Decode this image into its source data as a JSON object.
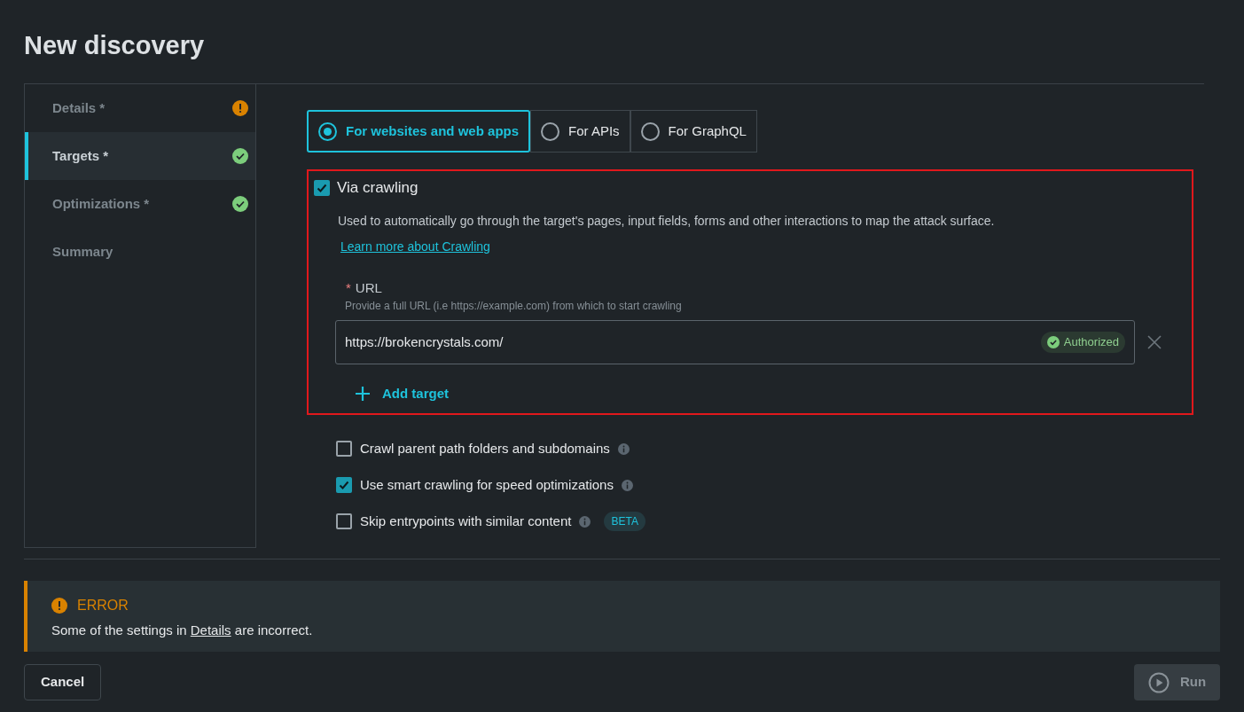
{
  "title": "New discovery",
  "steps": [
    {
      "label": "Details *",
      "selected": false,
      "kind": "error"
    },
    {
      "label": "Targets *",
      "selected": true,
      "kind": "ok"
    },
    {
      "label": "Optimizations *",
      "selected": false,
      "kind": "ok"
    },
    {
      "label": "Summary",
      "selected": false,
      "kind": "plain"
    }
  ],
  "target_types": [
    {
      "label": "For websites and web apps",
      "selected": true
    },
    {
      "label": "For APIs",
      "selected": false
    },
    {
      "label": "For GraphQL",
      "selected": false
    }
  ],
  "crawling": {
    "checked": true,
    "highlighted": true,
    "label": "Via crawling",
    "description": "Used to automatically go through the target's pages, input fields, forms and other interactions to map the attack surface.",
    "link": "Learn more about Crawling",
    "url_field": {
      "required_mark": "*",
      "label": "URL",
      "hint": "Provide a full URL (i.e https://example.com) from which to start crawling",
      "value": "https://brokencrystals.com/",
      "badge": "Authorized"
    },
    "add_target": "Add target"
  },
  "options": [
    {
      "label": "Crawl parent path folders and subdomains",
      "checked": false
    },
    {
      "label": "Use smart crawling for speed optimizations",
      "checked": true
    },
    {
      "label": "Skip entrypoints with similar content",
      "checked": false,
      "badge": "BETA"
    }
  ],
  "error": {
    "title": "ERROR",
    "before": "Some of the settings in ",
    "link": "Details",
    "after": " are incorrect."
  },
  "buttons": {
    "cancel": "Cancel",
    "run": "Run",
    "run_disabled": true
  }
}
